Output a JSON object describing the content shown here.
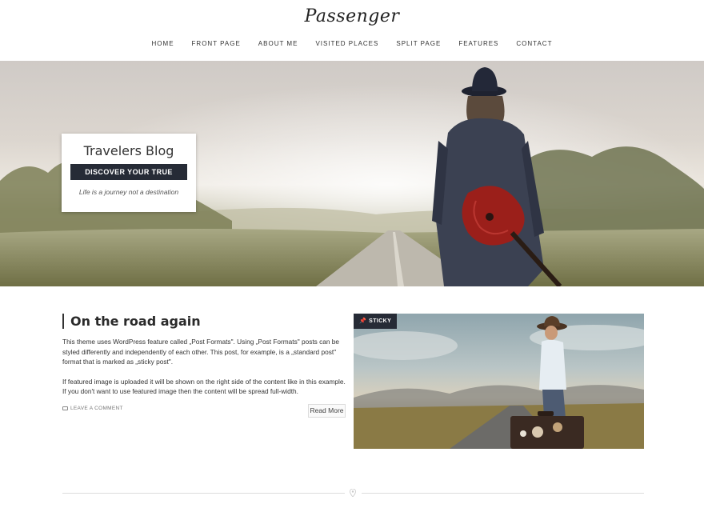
{
  "header": {
    "logo": "Passenger",
    "nav": [
      {
        "label": "Home"
      },
      {
        "label": "Front Page"
      },
      {
        "label": "About Me"
      },
      {
        "label": "Visited Places"
      },
      {
        "label": "Split Page"
      },
      {
        "label": "Features"
      },
      {
        "label": "Contact"
      }
    ]
  },
  "hero": {
    "title": "Travelers Blog",
    "button_label": "Discover your true nature",
    "tagline": "Life is a journey not a destination"
  },
  "post": {
    "title": "On the road again",
    "paragraphs": [
      "This theme uses WordPress feature called „Post Formats\". Using „Post Formats\" posts can be styled differently and independently of each other. This post, for example, is a „standard post\" format that is marked as „sticky post\".",
      "If featured image is uploaded it will be shown on the right side of the content like in this example. If you don't want to use featured image then the content will be spread full-width."
    ],
    "comment_link": "Leave a comment",
    "read_more": "Read More",
    "sticky_label": "Sticky"
  },
  "icons": {
    "comment": "comment-icon",
    "pin": "pin-icon",
    "location": "location-pin-icon"
  },
  "colors": {
    "dark_accent": "#262b36",
    "text": "#2b2b2b",
    "rule": "#dcdcdc"
  }
}
